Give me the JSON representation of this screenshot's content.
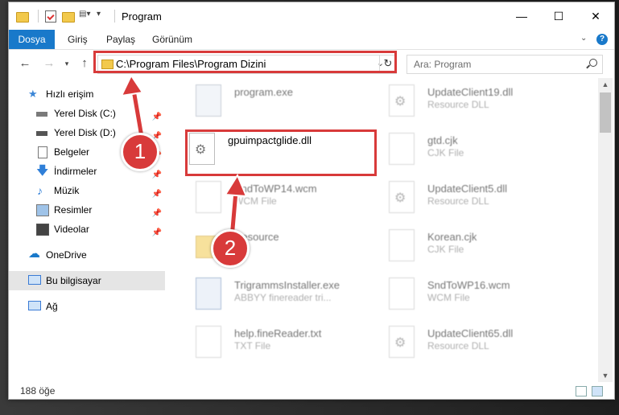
{
  "window": {
    "title": "Program",
    "controls": {
      "minimize": "—",
      "maximize": "☐",
      "close": "✕"
    }
  },
  "ribbon": {
    "tabs": [
      "Dosya",
      "Giriş",
      "Paylaş",
      "Görünüm"
    ]
  },
  "address": {
    "path": "C:\\Program Files\\Program Dizini",
    "search_placeholder": "Ara: Program"
  },
  "nav": {
    "quick_access": "Hızlı erişim",
    "items": [
      {
        "label": "Yerel Disk (C:)"
      },
      {
        "label": "Yerel Disk (D:)"
      },
      {
        "label": "Belgeler"
      },
      {
        "label": "İndirmeler"
      },
      {
        "label": "Müzik"
      },
      {
        "label": "Resimler"
      },
      {
        "label": "Videolar"
      }
    ],
    "onedrive": "OneDrive",
    "this_pc": "Bu bilgisayar",
    "network": "Ağ"
  },
  "files": [
    {
      "name": "program.exe",
      "type": ""
    },
    {
      "name": "UpdateClient19.dll",
      "type": "Resource DLL"
    },
    {
      "name": "gpuimpactglide.dll",
      "type": ""
    },
    {
      "name": "gtd.cjk",
      "type": "CJK File"
    },
    {
      "name": "SndToWP14.wcm",
      "type": "WCM File"
    },
    {
      "name": "UpdateClient5.dll",
      "type": "Resource DLL"
    },
    {
      "name": "Resource",
      "type": ""
    },
    {
      "name": "Korean.cjk",
      "type": "CJK File"
    },
    {
      "name": "TrigrammsInstaller.exe",
      "type": "ABBYY finereader tri..."
    },
    {
      "name": "SndToWP16.wcm",
      "type": "WCM File"
    },
    {
      "name": "help.fineReader.txt",
      "type": "TXT File"
    },
    {
      "name": "UpdateClient65.dll",
      "type": "Resource DLL"
    }
  ],
  "status": {
    "count": "188 öğe"
  },
  "annotations": {
    "step1": "1",
    "step2": "2"
  },
  "colors": {
    "accent": "#1979ca",
    "highlight": "#d83a3a"
  }
}
